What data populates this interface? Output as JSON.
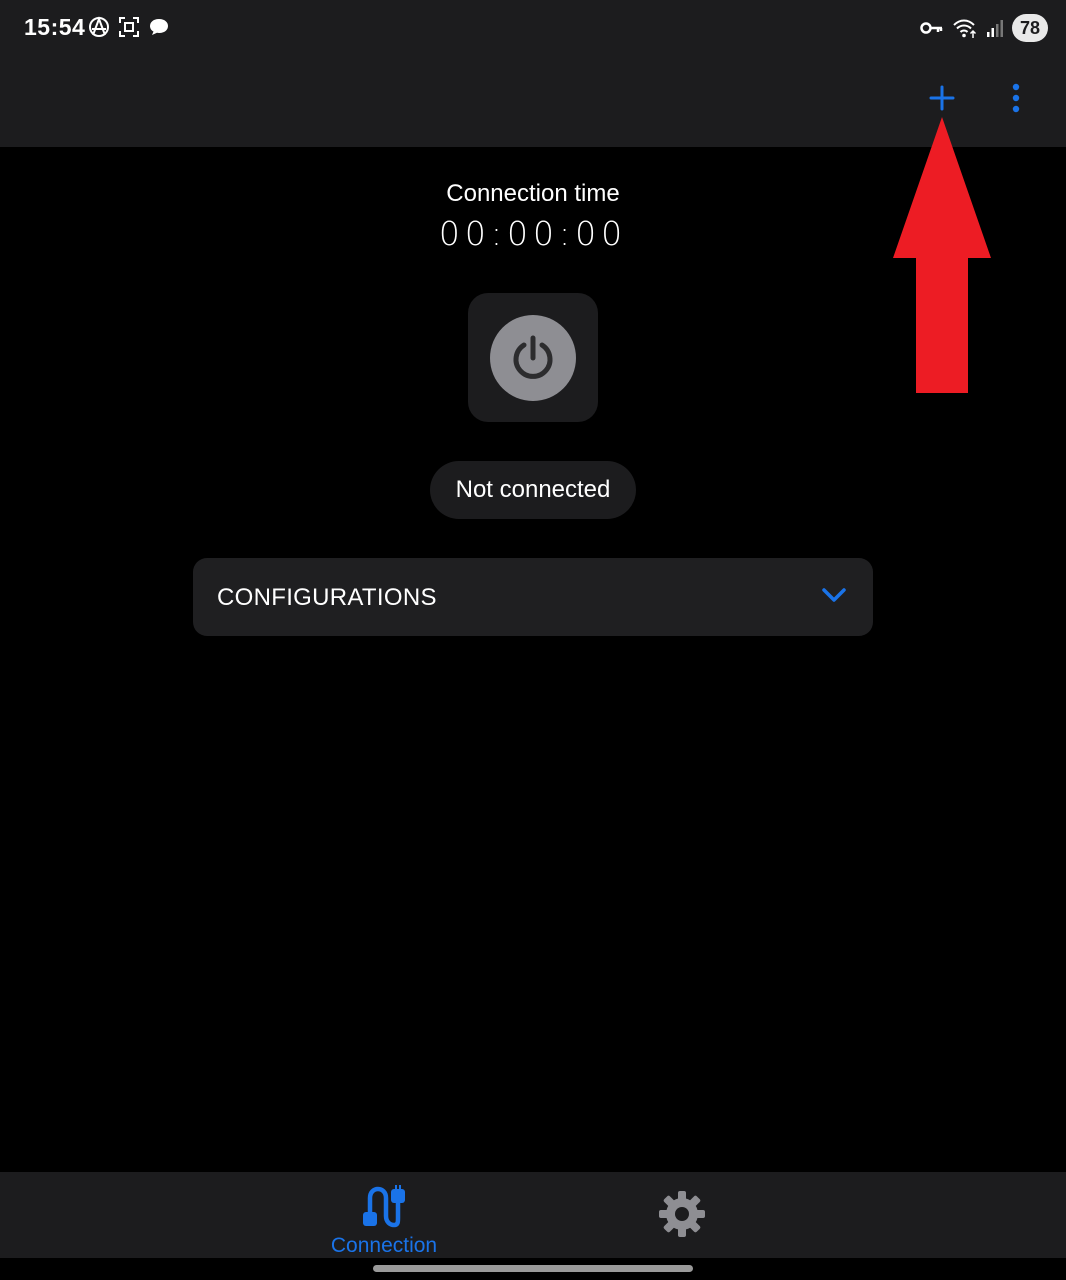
{
  "status_bar": {
    "time": "15:54",
    "left_icons": [
      "anarchy-icon",
      "scan-icon",
      "chat-bubble-icon"
    ],
    "right_icons": [
      "vpn-key-icon",
      "wifi-6-icon",
      "signal-icon"
    ],
    "battery": "78"
  },
  "app_bar": {
    "actions": [
      "add-icon",
      "more-vert-icon"
    ],
    "accent_color": "#1a73e8"
  },
  "main": {
    "connection_time_label": "Connection time",
    "connection_time_value": "00:00:00",
    "power_button_icon": "power-icon",
    "status_text": "Not connected",
    "configurations_label": "CONFIGURATIONS",
    "configurations_icon": "chevron-down-icon"
  },
  "annotation": {
    "type": "red-arrow",
    "color": "#ed1c24",
    "points_to": "add-button"
  },
  "bottom_nav": {
    "items": [
      {
        "label": "Connection",
        "icon": "cable-icon",
        "active": true
      },
      {
        "label": "",
        "icon": "gear-icon",
        "active": false
      }
    ],
    "active_color": "#1a73e8",
    "inactive_color": "#8e8e93"
  }
}
